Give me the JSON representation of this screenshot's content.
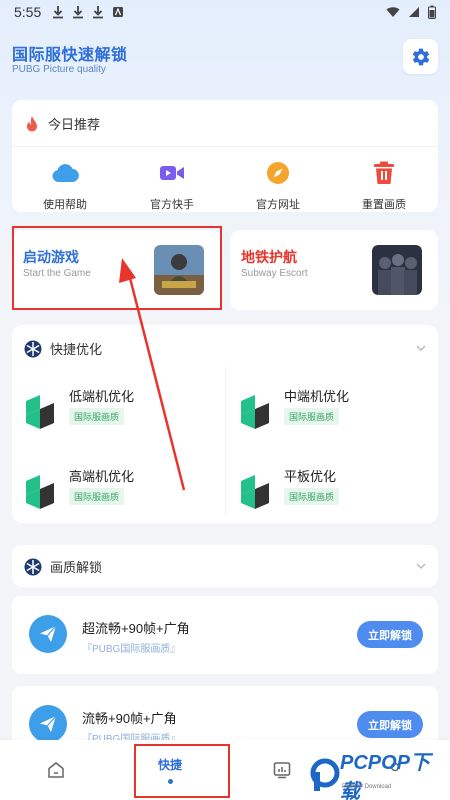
{
  "status_bar": {
    "time": "5:55"
  },
  "header": {
    "title": "国际服快速解锁",
    "subtitle": "PUBG Picture quality"
  },
  "today": {
    "title": "今日推荐",
    "items": [
      {
        "label": "使用帮助",
        "icon": "cloud-icon"
      },
      {
        "label": "官方快手",
        "icon": "video-camera-icon"
      },
      {
        "label": "官方网址",
        "icon": "compass-icon"
      },
      {
        "label": "重置画质",
        "icon": "trash-icon"
      }
    ]
  },
  "features": [
    {
      "title": "启动游戏",
      "subtitle": "Start the Game",
      "color": "#2f6fd8"
    },
    {
      "title": "地铁护航",
      "subtitle": "Subway Escort",
      "color": "#e8352c"
    }
  ],
  "optimize": {
    "title": "快捷优化",
    "items": [
      {
        "title": "低端机优化",
        "tag": "国际服画质"
      },
      {
        "title": "中端机优化",
        "tag": "国际服画质"
      },
      {
        "title": "高端机优化",
        "tag": "国际服画质"
      },
      {
        "title": "平板优化",
        "tag": "国际服画质"
      }
    ]
  },
  "unlock": {
    "title": "画质解锁",
    "items": [
      {
        "title": "超流畅+90帧+广角",
        "subtitle": "『PUBG国际服画质』",
        "button": "立即解锁"
      },
      {
        "title": "流畅+90帧+广角",
        "subtitle": "『PUBG国际服画质』",
        "button": "立即解锁"
      }
    ]
  },
  "bottom_nav": {
    "active_label": "快捷",
    "items": [
      "home-icon",
      "shortcut",
      "chart-icon",
      "user-icon"
    ]
  },
  "watermark": {
    "text": "PCPOP下载",
    "sub": "PCPOP Download"
  },
  "colors": {
    "accent": "#2f6fd8",
    "red_highlight": "#e8352c",
    "button_blue": "#4f8cf0"
  }
}
